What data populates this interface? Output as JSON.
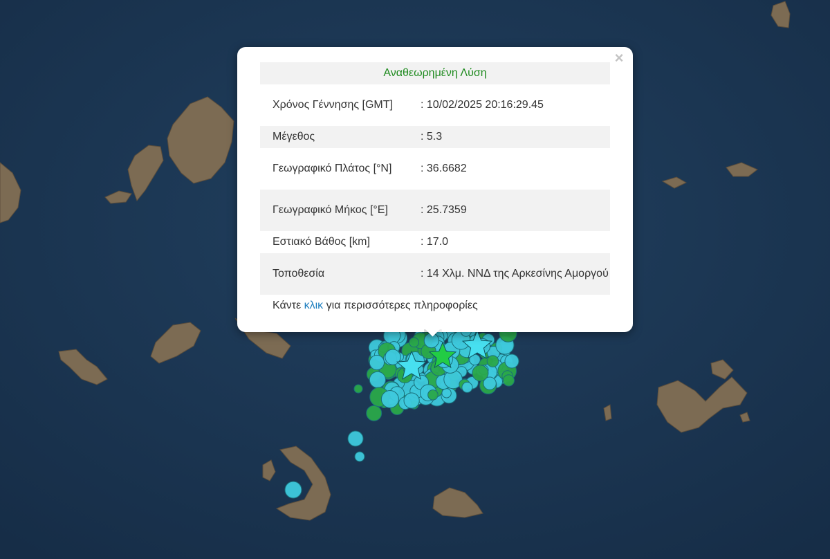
{
  "popup": {
    "title": "Αναθεωρημένη Λύση",
    "close_symbol": "×",
    "rows": [
      {
        "label": "Χρόνος Γέννησης [GMT]",
        "value": ": 10/02/2025 20:16:29.45"
      },
      {
        "label": "Μέγεθος",
        "value": ": 5.3"
      },
      {
        "label": "Γεωγραφικό Πλάτος [°N]",
        "value": ": 36.6682"
      },
      {
        "label": "Γεωγραφικό Μήκος [°E]",
        "value": ": 25.7359"
      },
      {
        "label": "Εστιακό Βάθος [km]",
        "value": ": 17.0"
      },
      {
        "label": "Τοποθεσία",
        "value": ": 14 Χλμ. ΝΝΔ της Αρκεσίνης Αμοργού"
      }
    ],
    "more_prefix": "Κάντε ",
    "more_link": "κλικ",
    "more_suffix": " για περισσότερες πληροφορίες"
  },
  "colors": {
    "sea": "#1b3654",
    "land": "#7a6a52",
    "quake_cyan": "#3ec9dc",
    "quake_green": "#2aa84a",
    "star_cyan": "#47e0f0",
    "star_green": "#22cc44"
  },
  "map": {
    "icons": [
      "earthquake-circle-marker",
      "earthquake-star-marker"
    ]
  }
}
